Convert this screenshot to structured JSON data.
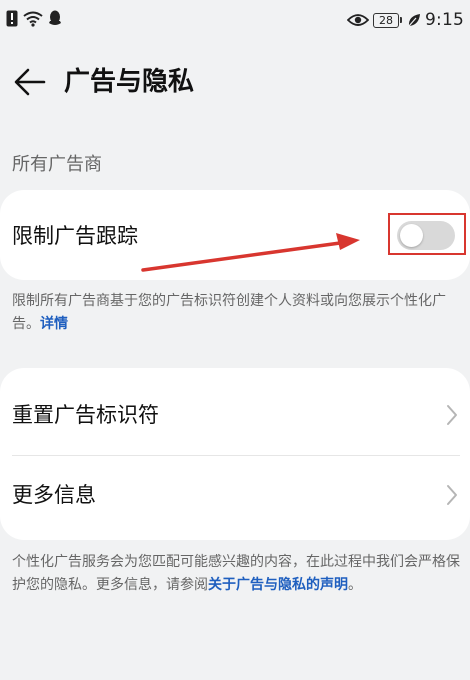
{
  "status_bar": {
    "battery_level": "28",
    "time": "9:15",
    "icons": [
      "alert-icon",
      "wifi-icon",
      "qq-icon",
      "eye-icon",
      "battery-icon",
      "leaf-icon"
    ]
  },
  "header": {
    "back_icon": "back-arrow-icon",
    "title": "广告与隐私"
  },
  "section": {
    "label": "所有广告商"
  },
  "limit_tracking": {
    "label": "限制广告跟踪",
    "toggle_on": false,
    "description": "限制所有广告商基于您的广告标识符创建个人资料或向您展示个性化广告。",
    "details_link": "详情"
  },
  "menu": {
    "items": [
      {
        "label": "重置广告标识符",
        "icon": "chevron-right-icon"
      },
      {
        "label": "更多信息",
        "icon": "chevron-right-icon"
      }
    ]
  },
  "footer": {
    "text": "个性化广告服务会为您匹配可能感兴趣的内容，在此过程中我们会严格保护您的隐私。更多信息，请参阅",
    "link": "关于广告与隐私的声明",
    "suffix": "。"
  },
  "colors": {
    "background": "#f1f2f3",
    "card": "#ffffff",
    "link": "#1f5fbf",
    "annotation": "#d8362f",
    "toggle_off": "#d9d9d9"
  }
}
